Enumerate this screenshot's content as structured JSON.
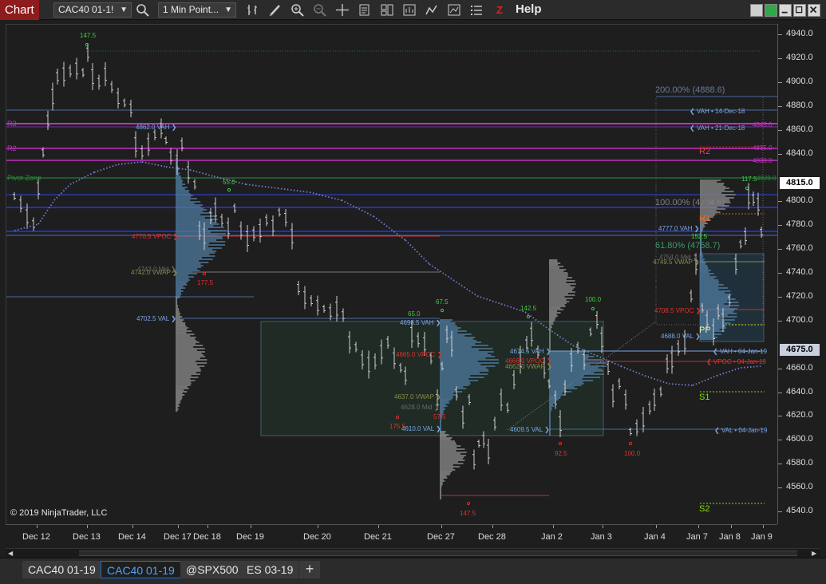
{
  "toolbar": {
    "chart_label": "Chart",
    "instrument": "CAC40 01-1!",
    "interval": "1 Min Point...",
    "help_label": "Help",
    "z_label": "Z",
    "tools": [
      "bars-icon",
      "pencil-icon",
      "zoom-in-icon",
      "zoom-out-icon",
      "crosshair-icon",
      "data-box-icon",
      "properties-icon",
      "strategies-icon",
      "indicators-icon",
      "chart-trader-icon",
      "list-icon"
    ]
  },
  "price_axis": {
    "labels": [
      "4940.0",
      "4920.0",
      "4900.0",
      "4880.0",
      "4860.0",
      "4840.0",
      "4815.0",
      "4800.0",
      "4780.0",
      "4760.0",
      "4740.0",
      "4720.0",
      "4700.0",
      "4675.0",
      "4660.0",
      "4640.0",
      "4620.0",
      "4600.0",
      "4580.0",
      "4560.0",
      "4540.0"
    ],
    "last_price": "4675.0",
    "other_price": "4815.0"
  },
  "time_axis": {
    "labels": [
      "Dec 12",
      "Dec 13",
      "Dec 14",
      "Dec 17",
      "Dec 18",
      "Dec 19",
      "Dec 20",
      "Dec 21",
      "Dec 27",
      "Dec 28",
      "Jan 2",
      "Jan 3",
      "Jan 4",
      "Jan 7",
      "Jan 8",
      "Jan 9"
    ]
  },
  "copyright": "© 2019 NinjaTrader, LLC",
  "levels": {
    "r3": "R3",
    "r2": "R2",
    "r1": "R1",
    "pp": "PP",
    "s1": "S1",
    "s2": "S2",
    "pivot_zone": "Pivot Zone"
  },
  "annotations": {
    "vah_14dec": "❮ VAH • 14-Dec-18",
    "vah_21dec": "❮ VAH • 21-Dec-18",
    "vah_04jan": "❮ VAH • 04-Jan-19",
    "vpoc_04jan": "❮ VPOC • 04-Jan-19",
    "val_04jan": "❮ VAL • 04-Jan-19",
    "vah_4862": "4862.0 VAH ❯",
    "vpoc_4770": "4770.5 VPOC ❯",
    "vwap_4742": "4742.0 VWAP ❯",
    "mid_4743": "4743.0 Mid ❯",
    "val_4702": "4702.5 VAL ❯",
    "vah_4698": "4698.5 VAH ❯",
    "vpoc_4665": "4665.0 VPOC ❯",
    "vwap_4637": "4637.0 VWAP ❯",
    "mid_4628": "4628.0 Mid ❯",
    "val_4610": "4610.0 VAL ❯",
    "vah_4674": "4674.5 VAH ❯",
    "vpoc_4666": "4666.0 VPOC ❯",
    "vwap_4662": "4662.0 VWAP ❯",
    "val_4609": "4609.5 VAL ❯",
    "vah_4777": "4777.0 VAH ❯",
    "mid_4754": "4754.0 Mid ❯",
    "vwap_4749": "4749.5 VWAP ❯",
    "vpoc_4708": "4708.5 VPOC ❯",
    "val_4688": "4688.0 VAL ❯",
    "fib_200": "200.00% (4888.6)",
    "fib_100": "100.00% (4794.6)",
    "fib_618": "61.80% (4758.7)",
    "small_4845": "4845.0",
    "small_4835": "4835.0",
    "small_4830": "4830.0",
    "small_4820": "4820.0"
  },
  "swing_labels": {
    "s1": "147.5",
    "s2": "55.0",
    "s3": "177.5",
    "s4": "65.0",
    "s5": "67.5",
    "s6": "175.5",
    "s7": "57.5",
    "s8": "147.5",
    "s9": "142.5",
    "s10": "100.0",
    "s11": "92.5",
    "s12": "100.0",
    "s13": "152.5",
    "s14": "117.5"
  },
  "tabs": [
    "CAC40 01-19",
    "CAC40 01-19",
    "@SPX500",
    "ES 03-19"
  ],
  "add_tab": "+",
  "colors": {
    "accent_red": "#8e1b1e",
    "up_green": "#3cd13c",
    "vpoc_red": "#e03030",
    "vah_blue": "#7aa7e8",
    "vwap_olive": "#8c8c4a",
    "pivot_magenta": "#c030c0",
    "last_price_bg": "#c8d0e0"
  }
}
